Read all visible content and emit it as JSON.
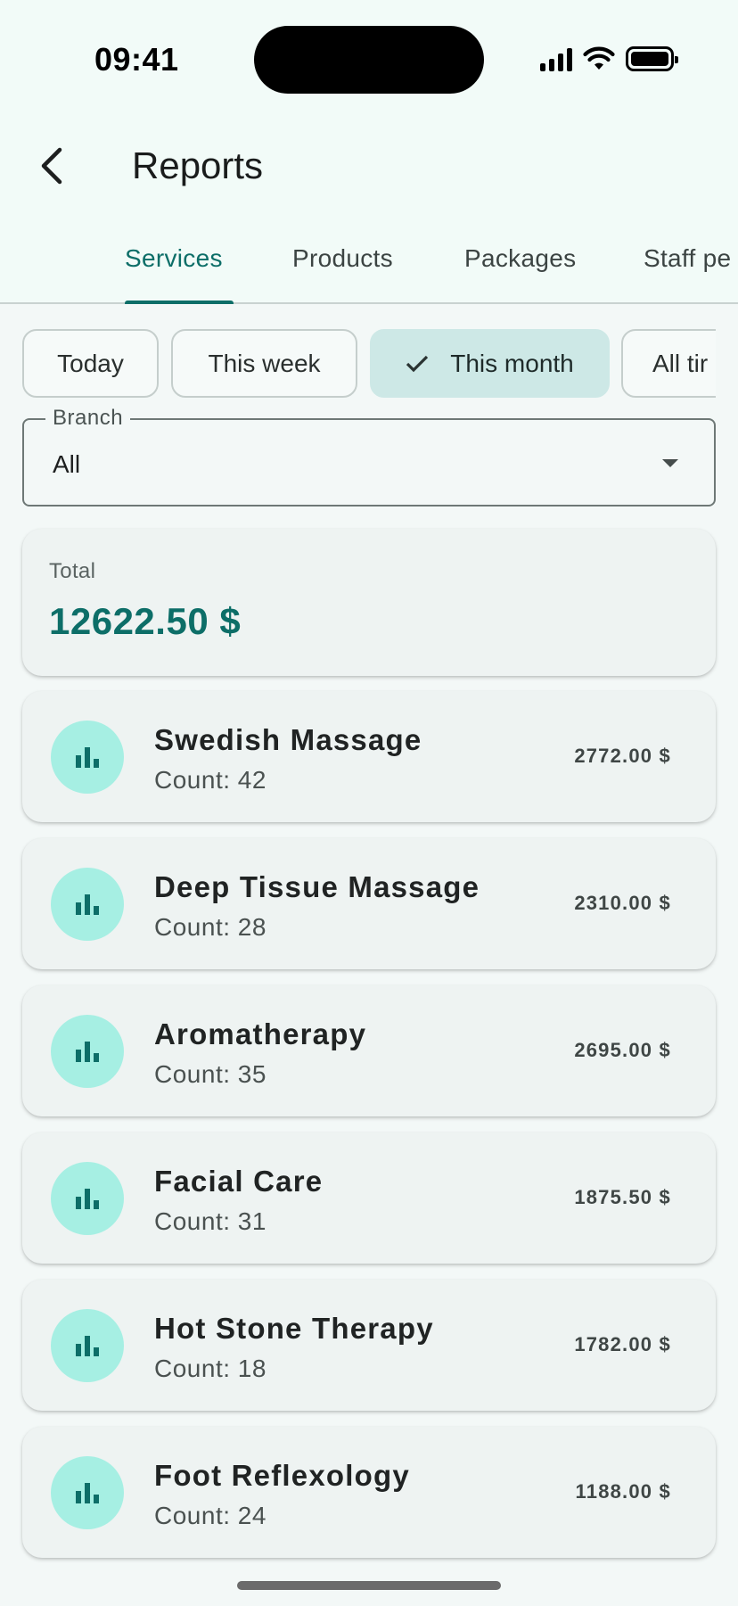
{
  "status_bar": {
    "time": "09:41"
  },
  "app_bar": {
    "title": "Reports"
  },
  "tabs": [
    {
      "label": "Services",
      "active": true
    },
    {
      "label": "Products",
      "active": false
    },
    {
      "label": "Packages",
      "active": false
    },
    {
      "label": "Staff pe",
      "active": false
    }
  ],
  "filters": [
    {
      "label": "Today",
      "selected": false
    },
    {
      "label": "This week",
      "selected": false
    },
    {
      "label": "This month",
      "selected": true
    },
    {
      "label": "All tir",
      "selected": false
    }
  ],
  "branch": {
    "label": "Branch",
    "value": "All"
  },
  "total": {
    "label": "Total",
    "value": "12622.50 $"
  },
  "services": [
    {
      "name": "Swedish Massage",
      "count": "Count: 42",
      "amount": "2772.00 $"
    },
    {
      "name": "Deep Tissue Massage",
      "count": "Count: 28",
      "amount": "2310.00 $"
    },
    {
      "name": "Aromatherapy",
      "count": "Count: 35",
      "amount": "2695.00 $"
    },
    {
      "name": "Facial Care",
      "count": "Count: 31",
      "amount": "1875.50 $"
    },
    {
      "name": "Hot Stone Therapy",
      "count": "Count: 18",
      "amount": "1782.00 $"
    },
    {
      "name": "Foot Reflexology",
      "count": "Count: 24",
      "amount": "1188.00 $"
    }
  ],
  "colors": {
    "accent": "#0d6e68",
    "icon_bg": "#a6efe3",
    "chip_selected": "#cde8e6"
  },
  "icons": {
    "back": "chevron-left-icon",
    "check": "check-icon",
    "dropdown": "arrow-drop-down-icon",
    "item": "bar-chart-icon"
  }
}
